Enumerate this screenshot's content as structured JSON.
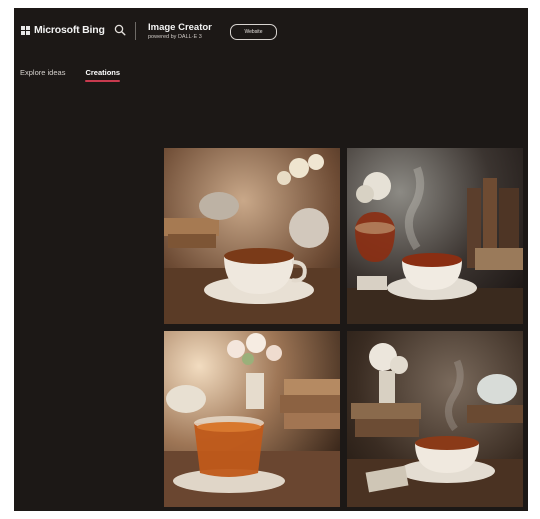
{
  "header": {
    "logo_text": "Microsoft Bing",
    "product_title": "Image Creator",
    "product_subtitle": "powered by DALL·E 3",
    "pill_label": "Website"
  },
  "tabs": [
    {
      "label": "Explore ideas",
      "active": false
    },
    {
      "label": "Creations",
      "active": true
    }
  ],
  "icons": {
    "logo": "windows-grid-icon",
    "search": "search-icon"
  },
  "colors": {
    "background": "#1c1816",
    "accent": "#c83a4e"
  },
  "gallery": {
    "image_count": 4
  }
}
